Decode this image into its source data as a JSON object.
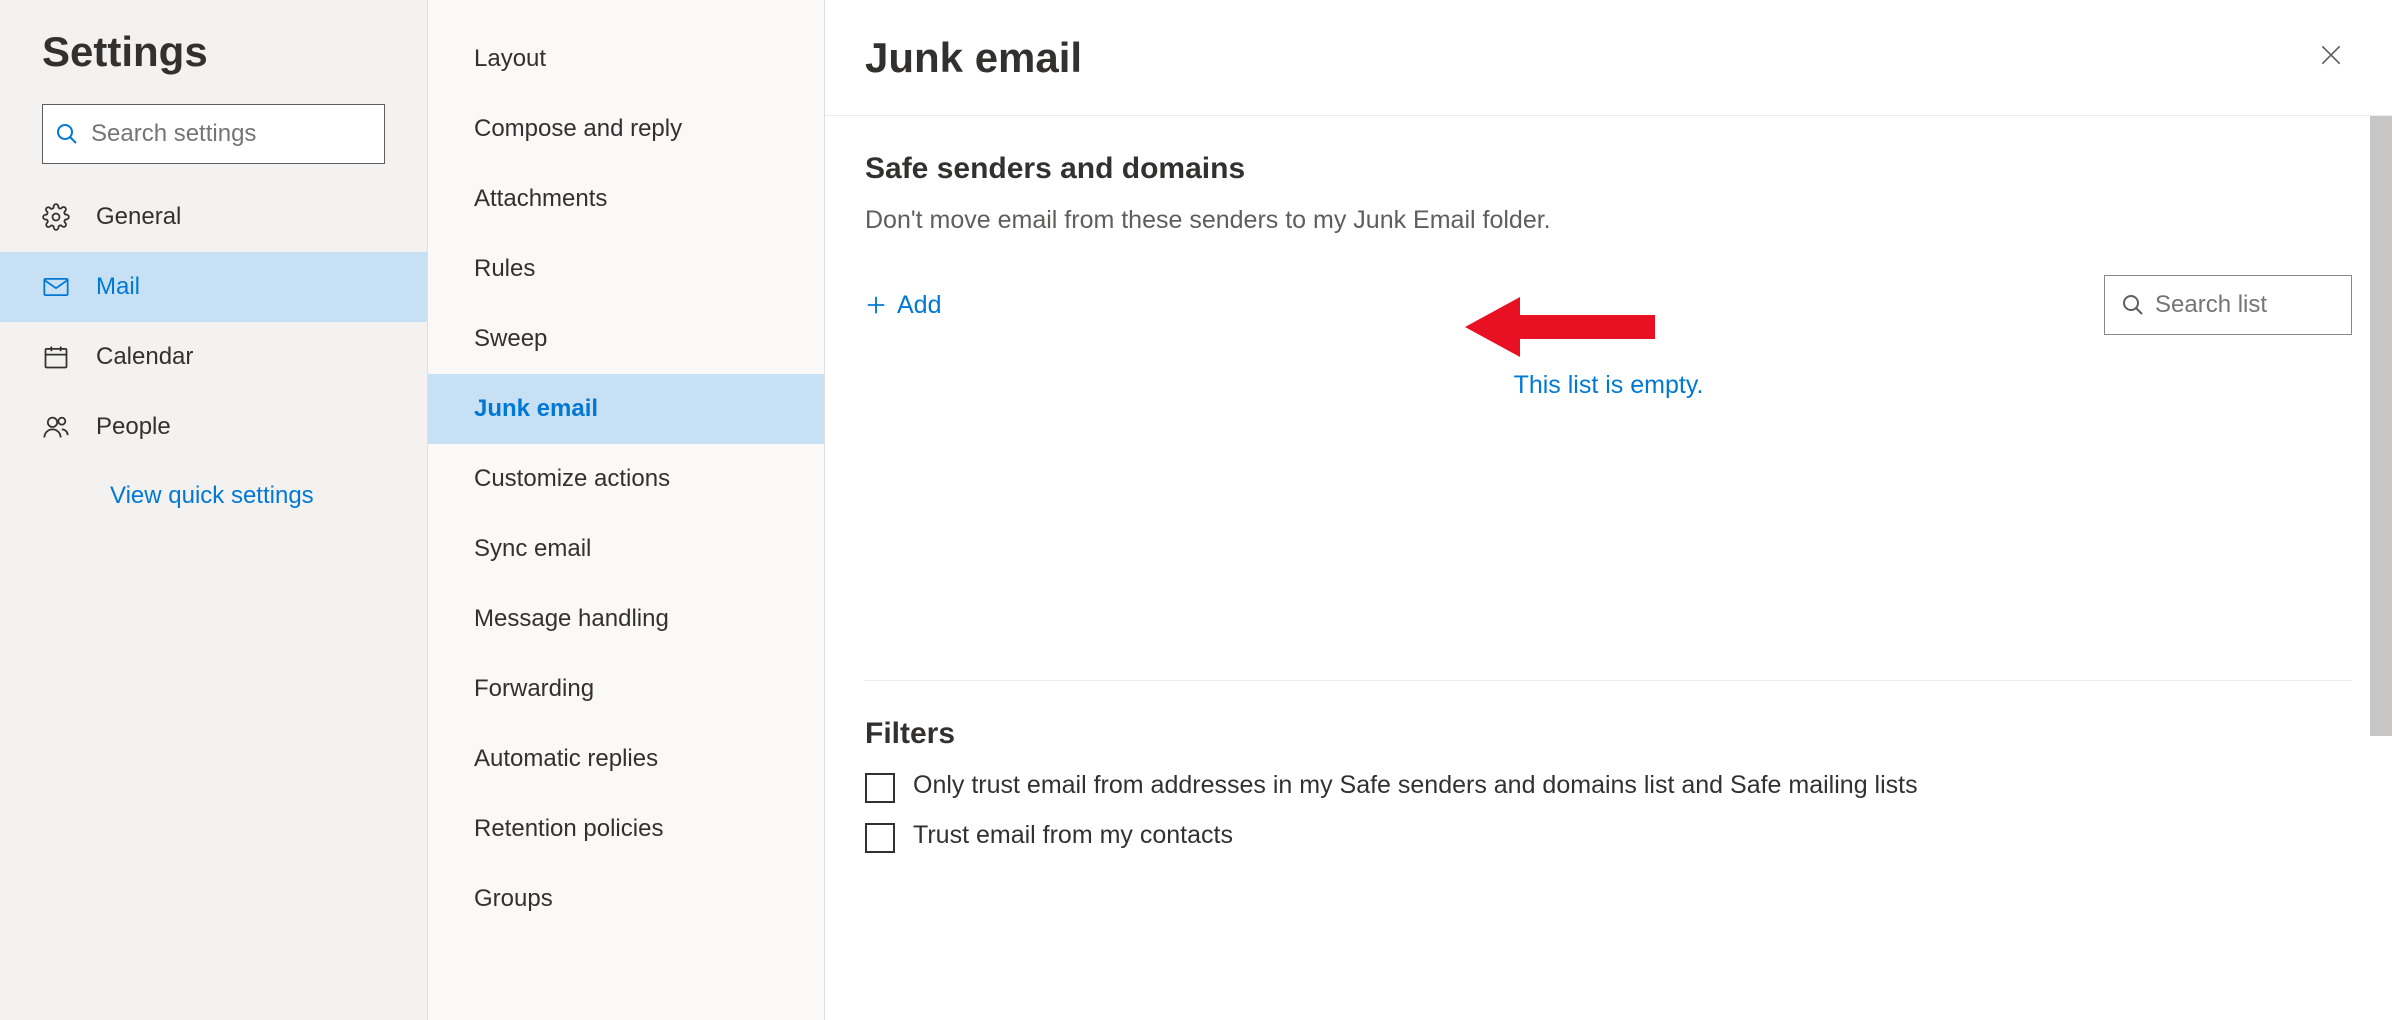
{
  "sidebar": {
    "title": "Settings",
    "search_placeholder": "Search settings",
    "nav": [
      {
        "label": "General",
        "selected": false
      },
      {
        "label": "Mail",
        "selected": true
      },
      {
        "label": "Calendar",
        "selected": false
      },
      {
        "label": "People",
        "selected": false
      }
    ],
    "quick_link": "View quick settings"
  },
  "submenu": {
    "items": [
      {
        "label": "Layout",
        "selected": false
      },
      {
        "label": "Compose and reply",
        "selected": false
      },
      {
        "label": "Attachments",
        "selected": false
      },
      {
        "label": "Rules",
        "selected": false
      },
      {
        "label": "Sweep",
        "selected": false
      },
      {
        "label": "Junk email",
        "selected": true
      },
      {
        "label": "Customize actions",
        "selected": false
      },
      {
        "label": "Sync email",
        "selected": false
      },
      {
        "label": "Message handling",
        "selected": false
      },
      {
        "label": "Forwarding",
        "selected": false
      },
      {
        "label": "Automatic replies",
        "selected": false
      },
      {
        "label": "Retention policies",
        "selected": false
      },
      {
        "label": "Groups",
        "selected": false
      }
    ]
  },
  "main": {
    "title": "Junk email",
    "safe_senders": {
      "heading": "Safe senders and domains",
      "description": "Don't move email from these senders to my Junk Email folder.",
      "add_label": "Add",
      "search_placeholder": "Search list",
      "empty_message": "This list is empty."
    },
    "filters": {
      "heading": "Filters",
      "options": [
        {
          "label": "Only trust email from addresses in my Safe senders and domains list and Safe mailing lists",
          "checked": false
        },
        {
          "label": "Trust email from my contacts",
          "checked": false
        }
      ]
    }
  }
}
